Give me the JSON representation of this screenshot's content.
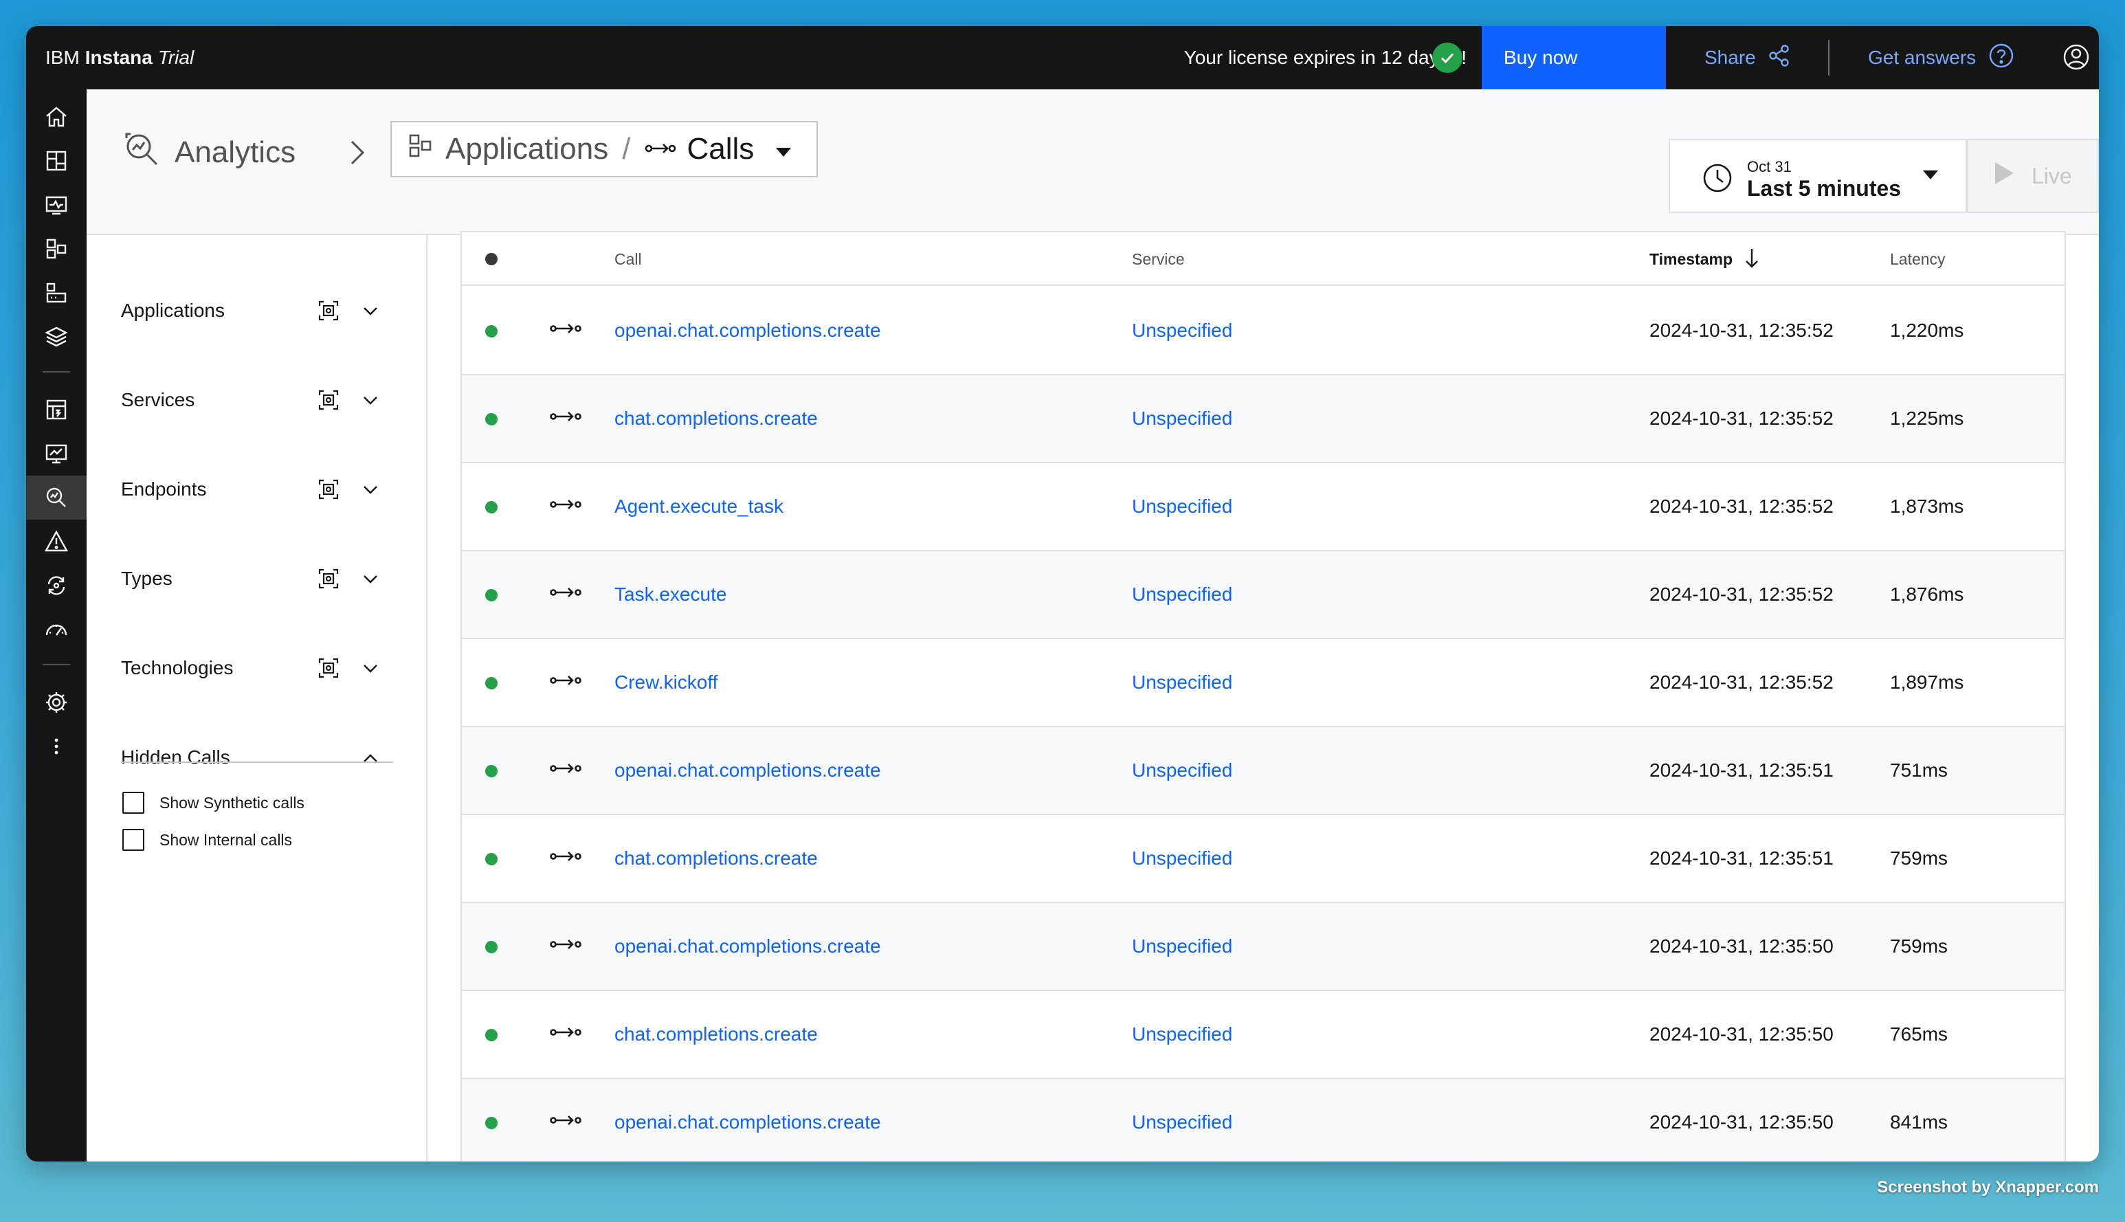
{
  "brand": {
    "company": "IBM",
    "product": "Instana",
    "edition": "Trial"
  },
  "topbar": {
    "license_text": "Your license expires in 12 day(s)!",
    "buy_now": "Buy now",
    "share": "Share",
    "get_answers": "Get answers"
  },
  "rail": {
    "icons": [
      "home-icon",
      "dashboards-icon",
      "websites-icon",
      "applications-icon",
      "infrastructure-icon",
      "stack-icon",
      "reports-icon",
      "synthetics-icon",
      "analytics-icon",
      "alerts-icon",
      "automation-icon",
      "performance-icon",
      "settings-icon",
      "more-icon"
    ],
    "active": "analytics-icon"
  },
  "header": {
    "analytics_label": "Analytics",
    "crumb_applications": "Applications",
    "crumb_separator": "/",
    "crumb_calls": "Calls",
    "time_date": "Oct 31",
    "time_range": "Last 5 minutes",
    "live_label": "Live"
  },
  "filters": {
    "groups": [
      {
        "label": "Applications"
      },
      {
        "label": "Services"
      },
      {
        "label": "Endpoints"
      },
      {
        "label": "Types"
      },
      {
        "label": "Technologies"
      }
    ],
    "hidden_calls": {
      "label": "Hidden Calls",
      "options": [
        {
          "label": "Show Synthetic calls",
          "checked": false
        },
        {
          "label": "Show Internal calls",
          "checked": false
        }
      ]
    }
  },
  "table": {
    "columns": {
      "call": "Call",
      "service": "Service",
      "timestamp": "Timestamp",
      "latency": "Latency"
    },
    "sort": {
      "column": "timestamp",
      "direction": "descending"
    },
    "rows": [
      {
        "call": "openai.chat.completions.create",
        "service": "Unspecified",
        "timestamp": "2024-10-31, 12:35:52",
        "latency": "1,220ms",
        "status": "success"
      },
      {
        "call": "chat.completions.create",
        "service": "Unspecified",
        "timestamp": "2024-10-31, 12:35:52",
        "latency": "1,225ms",
        "status": "success"
      },
      {
        "call": "Agent.execute_task",
        "service": "Unspecified",
        "timestamp": "2024-10-31, 12:35:52",
        "latency": "1,873ms",
        "status": "success"
      },
      {
        "call": "Task.execute",
        "service": "Unspecified",
        "timestamp": "2024-10-31, 12:35:52",
        "latency": "1,876ms",
        "status": "success"
      },
      {
        "call": "Crew.kickoff",
        "service": "Unspecified",
        "timestamp": "2024-10-31, 12:35:52",
        "latency": "1,897ms",
        "status": "success"
      },
      {
        "call": "openai.chat.completions.create",
        "service": "Unspecified",
        "timestamp": "2024-10-31, 12:35:51",
        "latency": "751ms",
        "status": "success"
      },
      {
        "call": "chat.completions.create",
        "service": "Unspecified",
        "timestamp": "2024-10-31, 12:35:51",
        "latency": "759ms",
        "status": "success"
      },
      {
        "call": "openai.chat.completions.create",
        "service": "Unspecified",
        "timestamp": "2024-10-31, 12:35:50",
        "latency": "759ms",
        "status": "success"
      },
      {
        "call": "chat.completions.create",
        "service": "Unspecified",
        "timestamp": "2024-10-31, 12:35:50",
        "latency": "765ms",
        "status": "success"
      },
      {
        "call": "openai.chat.completions.create",
        "service": "Unspecified",
        "timestamp": "2024-10-31, 12:35:50",
        "latency": "841ms",
        "status": "success"
      }
    ]
  },
  "colors": {
    "accent": "#0f62fe",
    "success": "#24a148",
    "topbar": "#161616",
    "link": "#78a9ff"
  },
  "watermark": "Screenshot by Xnapper.com"
}
